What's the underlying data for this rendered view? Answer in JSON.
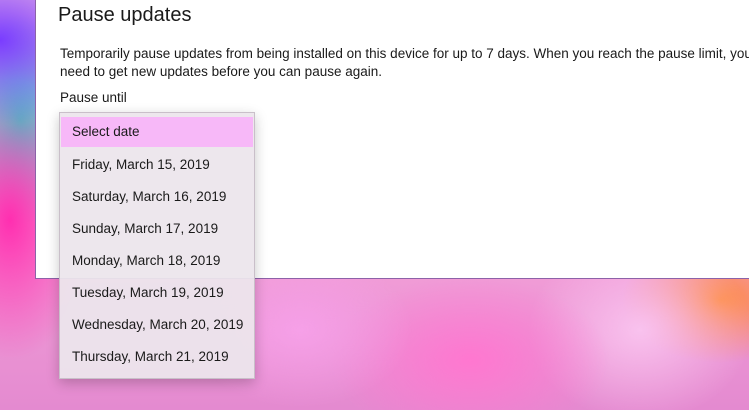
{
  "section": {
    "title": "Pause updates",
    "description_lines": [
      "Temporarily pause updates from being installed on this device for up to 7 days. When you reach the pause limit, you'll",
      "need to get new updates before you can pause again."
    ],
    "pause_until_label": "Pause until"
  },
  "dropdown": {
    "selected_value": "Select date",
    "options": [
      "Select date",
      "Friday, March 15, 2019",
      "Saturday, March 16, 2019",
      "Sunday, March 17, 2019",
      "Monday, March 18, 2019",
      "Tuesday, March 19, 2019",
      "Wednesday, March 20, 2019",
      "Thursday, March 21, 2019"
    ]
  },
  "colors": {
    "selection_highlight": "#f7b8f8",
    "panel_border": "#8c62a8"
  }
}
